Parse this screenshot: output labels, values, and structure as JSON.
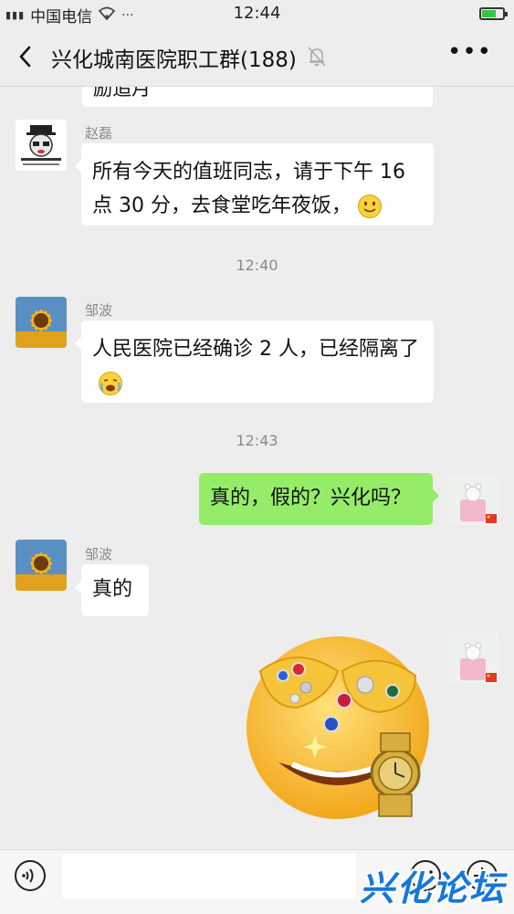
{
  "status_bar": {
    "carrier": "中国电信",
    "time": "12:44",
    "battery_level": 0.7,
    "battery_color": "#3cc43c"
  },
  "nav": {
    "title": "兴化城南医院职工群(188)",
    "back_icon": "chevron-left-icon",
    "mute_icon": "bell-muted-icon",
    "more_icon": "more-dots-icon"
  },
  "messages": {
    "partial_text": "励追月",
    "msg1": {
      "sender": "赵磊",
      "text": "所有今天的值班同志，请于下午 16 点 30 分，去食堂吃年夜饭，"
    },
    "time1": "12:40",
    "msg2": {
      "sender": "邹波",
      "text": "人民医院已经确诊 2 人，已经隔离了"
    },
    "time2": "12:43",
    "msg3": {
      "text": "真的，假的？兴化吗？"
    },
    "msg4": {
      "sender": "邹波",
      "text": "真的"
    },
    "msg5": {
      "sticker": "jewelry-emoji-sticker"
    }
  },
  "colors": {
    "background": "#ededed",
    "self_bubble": "#95ec69",
    "other_bubble": "#ffffff"
  },
  "watermark": "兴化论坛"
}
